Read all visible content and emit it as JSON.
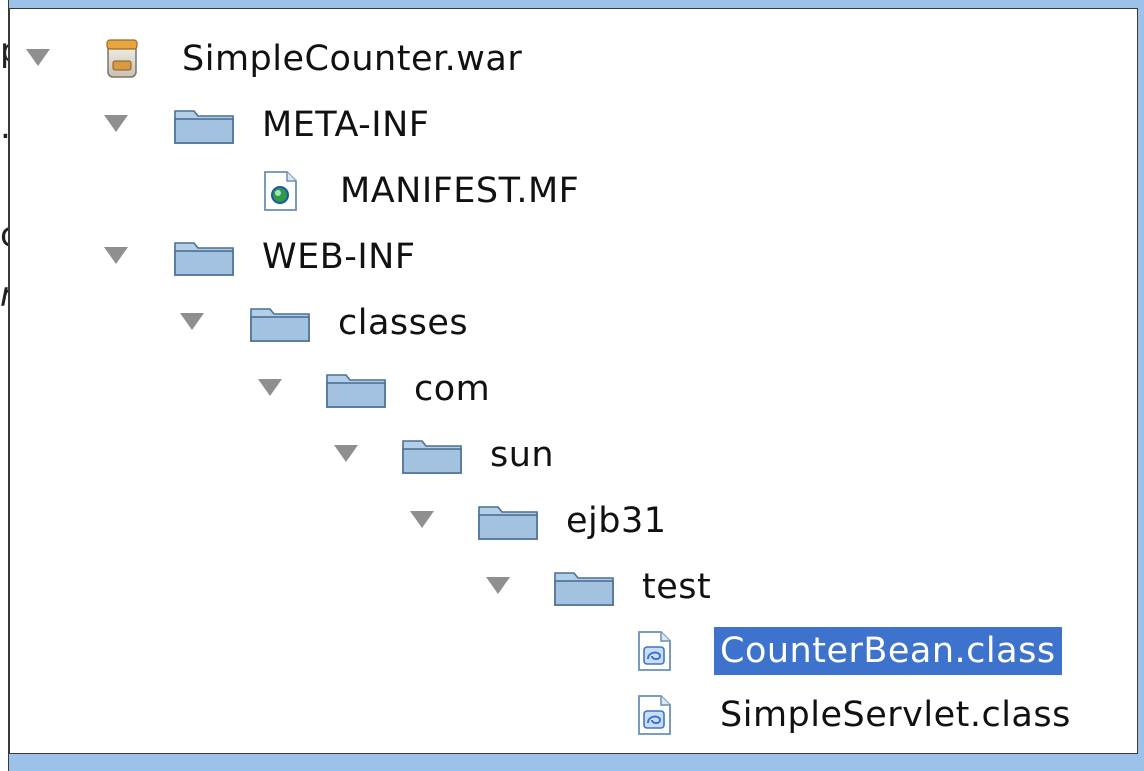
{
  "tree": {
    "root": "SimpleCounter.war",
    "meta_inf": "META-INF",
    "manifest": "MANIFEST.MF",
    "web_inf": "WEB-INF",
    "classes": "classes",
    "com": "com",
    "sun": "sun",
    "ejb31": "ejb31",
    "test": "test",
    "counter_bean": "CounterBean.class",
    "simple_servlet": "SimpleServlet.class"
  },
  "selected_item": "CounterBean.class",
  "icons": {
    "archive": "jar-archive-icon",
    "folder": "folder-icon",
    "manifest": "manifest-file-icon",
    "class_file": "class-file-icon",
    "expander": "expanded-triangle-icon"
  },
  "colors": {
    "frame": "#9cc2ea",
    "selection": "#3e73cd",
    "folder_fill": "#b3cfe8",
    "expander": "#8f8f8f"
  }
}
